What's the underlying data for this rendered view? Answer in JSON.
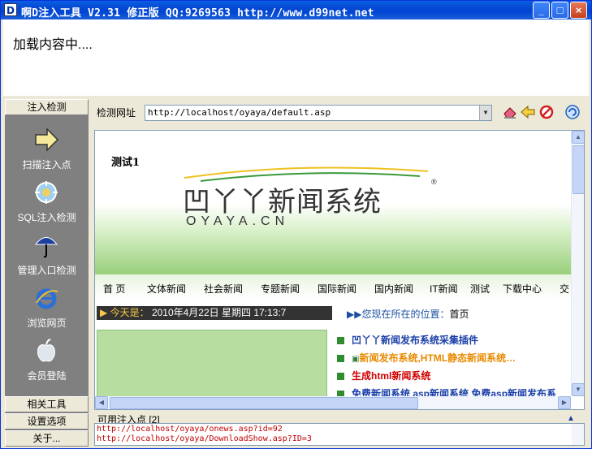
{
  "window": {
    "app_icon": "D",
    "title": "啊D注入工具 V2.31 修正版 QQ:9269563 http://www.d99net.net",
    "minimize": "_",
    "maximize": "□",
    "close": "×"
  },
  "loading": {
    "text": "加载内容中...."
  },
  "sidebar": {
    "header_top": "注入检测",
    "items": [
      {
        "label": "扫描注入点",
        "icon": "arrow-right-icon"
      },
      {
        "label": "SQL注入检测",
        "icon": "sql-scan-icon"
      },
      {
        "label": "管理入口检测",
        "icon": "umbrella-icon"
      },
      {
        "label": "浏览网页",
        "icon": "ie-browser-icon"
      },
      {
        "label": "会员登陆",
        "icon": "apple-logo-icon"
      }
    ],
    "footer": [
      "相关工具",
      "设置选项",
      "关于..."
    ]
  },
  "toolbar": {
    "url_label": "检测网址",
    "url_value": "http://localhost/oyaya/default.asp",
    "dropdown": "▼"
  },
  "browser": {
    "test_heading": "测试1",
    "logo_cn": "凹丫丫新闻系统",
    "logo_en": "OYAYA.CN",
    "registered": "®",
    "nav": [
      "首  页",
      "文体新闻",
      "社会新闻",
      "专题新闻",
      "国际新闻",
      "国内新闻",
      "IT新闻",
      "测试",
      "下载中心",
      "交"
    ],
    "date_label": "今天是：",
    "date_value": "2010年4月22日 星期四 17:13:7",
    "location_label": "您现在所在的位置：",
    "location_value": "首页",
    "news": [
      {
        "text": "凹丫丫新闻发布系统采集插件",
        "color": "#1a3fa8"
      },
      {
        "text": "新闻发布系统,HTML静态新闻系统…",
        "color": "#e88a00"
      },
      {
        "text": "生成html新闻系统",
        "color": "#d00000"
      },
      {
        "text": "免费新闻系统 asp新闻系统 免费asp新闻发布系",
        "color": "#1a3fa8"
      }
    ]
  },
  "injection": {
    "label": "可用注入点 [2]",
    "rows": [
      "http://localhost/oyaya/onews.asp?id=92",
      "http://localhost/oyaya/DownloadShow.asp?ID=3"
    ]
  },
  "colors": {
    "titlebar": "#0447d0",
    "sidebar_bg": "#808080",
    "green_accent": "#9bd07e",
    "injection_text": "#c00000"
  }
}
